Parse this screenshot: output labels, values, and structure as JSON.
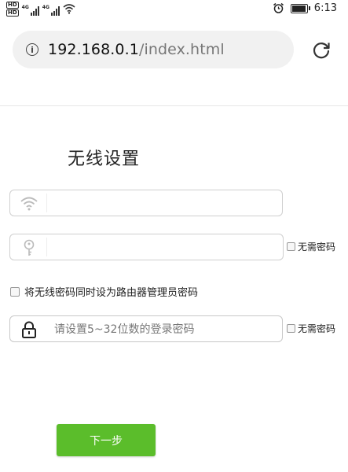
{
  "status_bar": {
    "hd_label": "HD",
    "net_label": "4G",
    "time": "6:13",
    "battery_level": 0.85
  },
  "browser": {
    "url_host": "192.168.0.1",
    "url_path": "/index.html",
    "info_icon": "info-icon",
    "reload_icon": "reload-icon"
  },
  "page": {
    "title": "无线设置",
    "wifi_name_field": {
      "value": "",
      "icon": "wifi-icon"
    },
    "wifi_password_field": {
      "value": "",
      "icon": "key-icon"
    },
    "no_password_label_1": "无需密码",
    "same_password_label": "将无线密码同时设为路由器管理员密码",
    "admin_password_field": {
      "placeholder": "请设置5~32位数的登录密码",
      "icon": "lock-icon"
    },
    "no_password_label_2": "无需密码",
    "next_button": "下一步"
  },
  "colors": {
    "accent": "#5bbd2b",
    "border": "#cfcfcf"
  }
}
